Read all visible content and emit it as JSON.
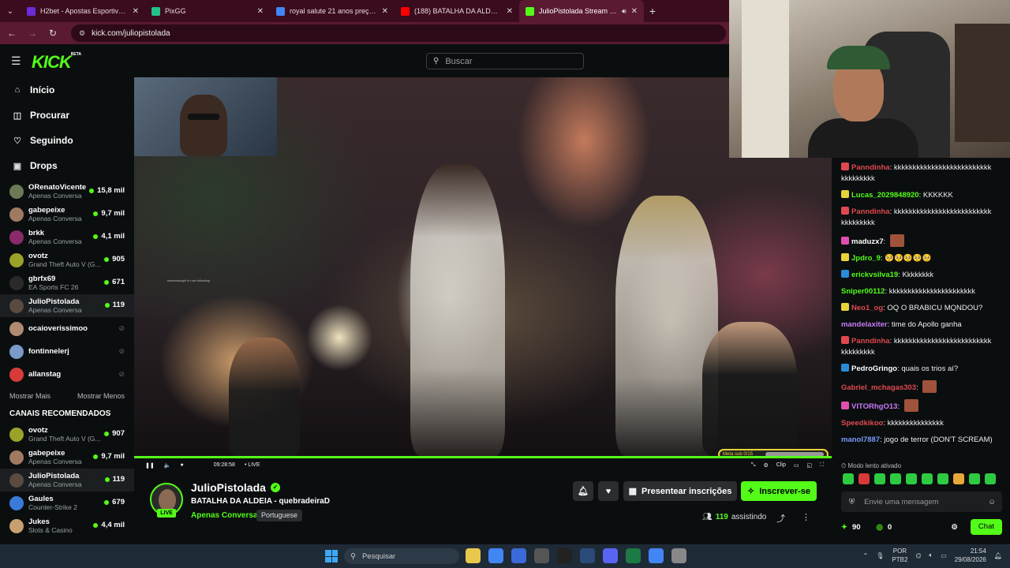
{
  "browser": {
    "tabs": [
      {
        "title": "H2bet - Apostas Esportivas e C",
        "color": "#6a2bd8",
        "active": false
      },
      {
        "title": "PixGG",
        "color": "#22c28a",
        "active": false
      },
      {
        "title": "royal salute 21 anos preço - Pe",
        "color": "#4285f4",
        "active": false
      },
      {
        "title": "(188) BATALHA DA ALDEIA - ES",
        "color": "#ff0000",
        "active": false
      },
      {
        "title": "JulioPistolada Stream - Wat",
        "color": "#53fc18",
        "active": true
      }
    ],
    "url": "kick.com/juliopistolada"
  },
  "kick": {
    "logo": "KICK",
    "logo_badge": "BETA",
    "search_placeholder": "Buscar"
  },
  "sidebar": {
    "nav": [
      {
        "label": "Início",
        "icon": "home-icon",
        "glyph": "⌂"
      },
      {
        "label": "Procurar",
        "icon": "browse-icon",
        "glyph": "◫"
      },
      {
        "label": "Seguindo",
        "icon": "heart-icon",
        "glyph": "♡"
      },
      {
        "label": "Drops",
        "icon": "gift-icon",
        "glyph": "▣"
      }
    ],
    "following": [
      {
        "name": "ORenatoVicente",
        "sub": "Apenas Conversa",
        "viewers": "15,8 mil",
        "live": true,
        "color": "#6b7a55"
      },
      {
        "name": "gabepeixe",
        "sub": "Apenas Conversa",
        "viewers": "9,7 mil",
        "live": true,
        "color": "#a07a60"
      },
      {
        "name": "brkk",
        "sub": "Apenas Conversa",
        "viewers": "4,1 mil",
        "live": true,
        "color": "#8a2a6a"
      },
      {
        "name": "ovotz",
        "sub": "Grand Theft Auto V (G...",
        "viewers": "905",
        "live": true,
        "color": "#9aa22a"
      },
      {
        "name": "gbrfx69",
        "sub": "EA Sports FC 26",
        "viewers": "671",
        "live": true,
        "color": "#2a2a2a"
      },
      {
        "name": "JulioPistolada",
        "sub": "Apenas Conversa",
        "viewers": "119",
        "live": true,
        "color": "#5a4a40",
        "selected": true
      },
      {
        "name": "ocaioverissimoo",
        "sub": "",
        "viewers": "",
        "live": false,
        "color": "#b08a70"
      },
      {
        "name": "fontinnelerj",
        "sub": "",
        "viewers": "",
        "live": false,
        "color": "#7a9ac8"
      },
      {
        "name": "allanstag",
        "sub": "",
        "viewers": "",
        "live": false,
        "color": "#d83a3a"
      }
    ],
    "show_more": "Mostrar Mais",
    "show_less": "Mostrar Menos",
    "recommended_title": "CANAIS RECOMENDADOS",
    "recommended": [
      {
        "name": "ovotz",
        "sub": "Grand Theft Auto V (G...",
        "viewers": "907",
        "color": "#9aa22a"
      },
      {
        "name": "gabepeixe",
        "sub": "Apenas Conversa",
        "viewers": "9,7 mil",
        "color": "#a07a60"
      },
      {
        "name": "JulioPistolada",
        "sub": "Apenas Conversa",
        "viewers": "119",
        "color": "#5a4a40",
        "selected": true
      },
      {
        "name": "Gaules",
        "sub": "Counter-Strike 2",
        "viewers": "679",
        "color": "#3a7ad8"
      },
      {
        "name": "Jukes",
        "sub": "Slots & Casino",
        "viewers": "4,4 mil",
        "color": "#c8a070"
      }
    ]
  },
  "player": {
    "time": "09:28:58",
    "live_label": "• LIVE",
    "follow_note": "smecaraduph is now following!",
    "sub_goal": "Meta sub 0/15",
    "sub_goal_fraction": 0.0,
    "clip_label": "Clip"
  },
  "chat": {
    "messages": [
      {
        "user": "Panndinha",
        "color": "#e0484f",
        "badge_color": "#e0484f",
        "badge": "26",
        "text": "kkkkkkkkkkkkkkkkkkkkkkkkkkkkkkkkkkk"
      },
      {
        "user": "Lucas_2029848920",
        "color": "#53fc18",
        "badge_color": "#e8d23a",
        "badge": "13",
        "text": "KKKKKK"
      },
      {
        "user": "Panndinha",
        "color": "#e0484f",
        "badge_color": "#e0484f",
        "badge": "26",
        "text": "kkkkkkkkkkkkkkkkkkkkkkkkkkkkkkkkkkk"
      },
      {
        "user": "maduzx7",
        "color": "#fff",
        "badge_color": "#e04fb0",
        "badge": "26",
        "text": "",
        "emote": true
      },
      {
        "user": "Jpdro_9",
        "color": "#53fc18",
        "badge_color": "#e8d23a",
        "badge": "13",
        "text": "🥺🥺🥺🥺🥺"
      },
      {
        "user": "erickvsilva19",
        "color": "#53fc18",
        "badge_color": "#2a8ad8",
        "badge": "31",
        "text": "Kkkkkkkk"
      },
      {
        "user": "Sniper00112",
        "color": "#53fc18",
        "badge_color": "",
        "badge": "",
        "text": "kkkkkkkkkkkkkkkkkkkkkkk"
      },
      {
        "user": "Neo1_og",
        "color": "#e0484f",
        "badge_color": "#e8d23a",
        "badge": "13",
        "text": "OQ O BRABICU MQNDOU?"
      },
      {
        "user": "mandelaxiter",
        "color": "#c87af8",
        "badge_color": "",
        "badge": "",
        "text": "time do Apollo ganha"
      },
      {
        "user": "Panndinha",
        "color": "#e0484f",
        "badge_color": "#e0484f",
        "badge": "26",
        "text": "kkkkkkkkkkkkkkkkkkkkkkkkkkkkkkkkkkk"
      },
      {
        "user": "PedroGringo",
        "color": "#fff",
        "badge_color": "#2a8ad8",
        "badge": "",
        "text": "quais os trios aí?"
      },
      {
        "user": "Gabriel_mchagas303",
        "color": "#e0484f",
        "badge_color": "",
        "badge": "",
        "text": "",
        "emote": true
      },
      {
        "user": "VITORhgO13",
        "color": "#c87af8",
        "badge_color": "#e04fb0",
        "badge": "26",
        "text": "",
        "emote": true
      },
      {
        "user": "Speedkikoo",
        "color": "#e0484f",
        "badge_color": "",
        "badge": "",
        "text": "kkkkkkkkkkkkkkk"
      },
      {
        "user": "manol7887",
        "color": "#7a9af8",
        "badge_color": "",
        "badge": "",
        "text": "jogo de terror (DON'T SCREAM)"
      }
    ],
    "slow_mode": "Modo lento ativado",
    "input_placeholder": "Envie uma mensagem",
    "points": "90",
    "kicks": "0",
    "chat_button": "Chat"
  },
  "stream": {
    "name": "JulioPistolada",
    "title": "BATALHA DA ALDEIA - quebradeiraD",
    "category": "Apenas Conversa",
    "language": "Portuguese",
    "gift_label": "Presentear inscrições",
    "subscribe_label": "Inscrever-se",
    "viewers": "119",
    "viewers_label": "assistindo",
    "live_badge": "LIVE"
  },
  "taskbar": {
    "search_placeholder": "Pesquisar",
    "apps": [
      "#e8c84a",
      "#4285f4",
      "#3a6ad8",
      "#555",
      "#222",
      "#2a4a7a",
      "#5865f2",
      "#1e7a44",
      "#4285f4",
      "#888"
    ],
    "lang": "POR",
    "layout": "PTB2",
    "time": "21:54",
    "date": "29/08/2026"
  }
}
